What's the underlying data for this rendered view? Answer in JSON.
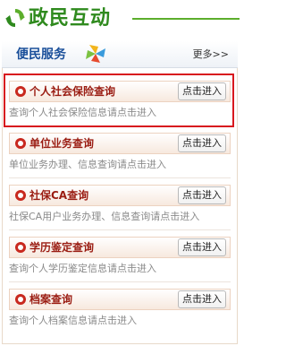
{
  "header": {
    "title": "政民互动",
    "icon": "refresh-arrows-icon",
    "accent_color": "#2f8a1e"
  },
  "section": {
    "title": "便民服务",
    "more_label": "更多>>",
    "title_color": "#1a4f9a"
  },
  "services": [
    {
      "title": "个人社会保险查询",
      "button": "点击进入",
      "desc": "查询个人社会保险信息请点击进入",
      "highlighted": true
    },
    {
      "title": "单位业务查询",
      "button": "点击进入",
      "desc": "单位业务办理、信息查询请点击进入",
      "highlighted": false
    },
    {
      "title": "社保CA查询",
      "button": "点击进入",
      "desc": "社保CA用户业务办理、信息查询请点击进入",
      "highlighted": false
    },
    {
      "title": "学历鉴定查询",
      "button": "点击进入",
      "desc": "查询个人学历鉴定信息请点击进入",
      "highlighted": false
    },
    {
      "title": "档案查询",
      "button": "点击进入",
      "desc": "查询个人档案信息请点击进入",
      "highlighted": false
    }
  ],
  "colors": {
    "bullet": "#c8281e",
    "card_title": "#9a1c12",
    "highlight_border": "#d8181e"
  }
}
